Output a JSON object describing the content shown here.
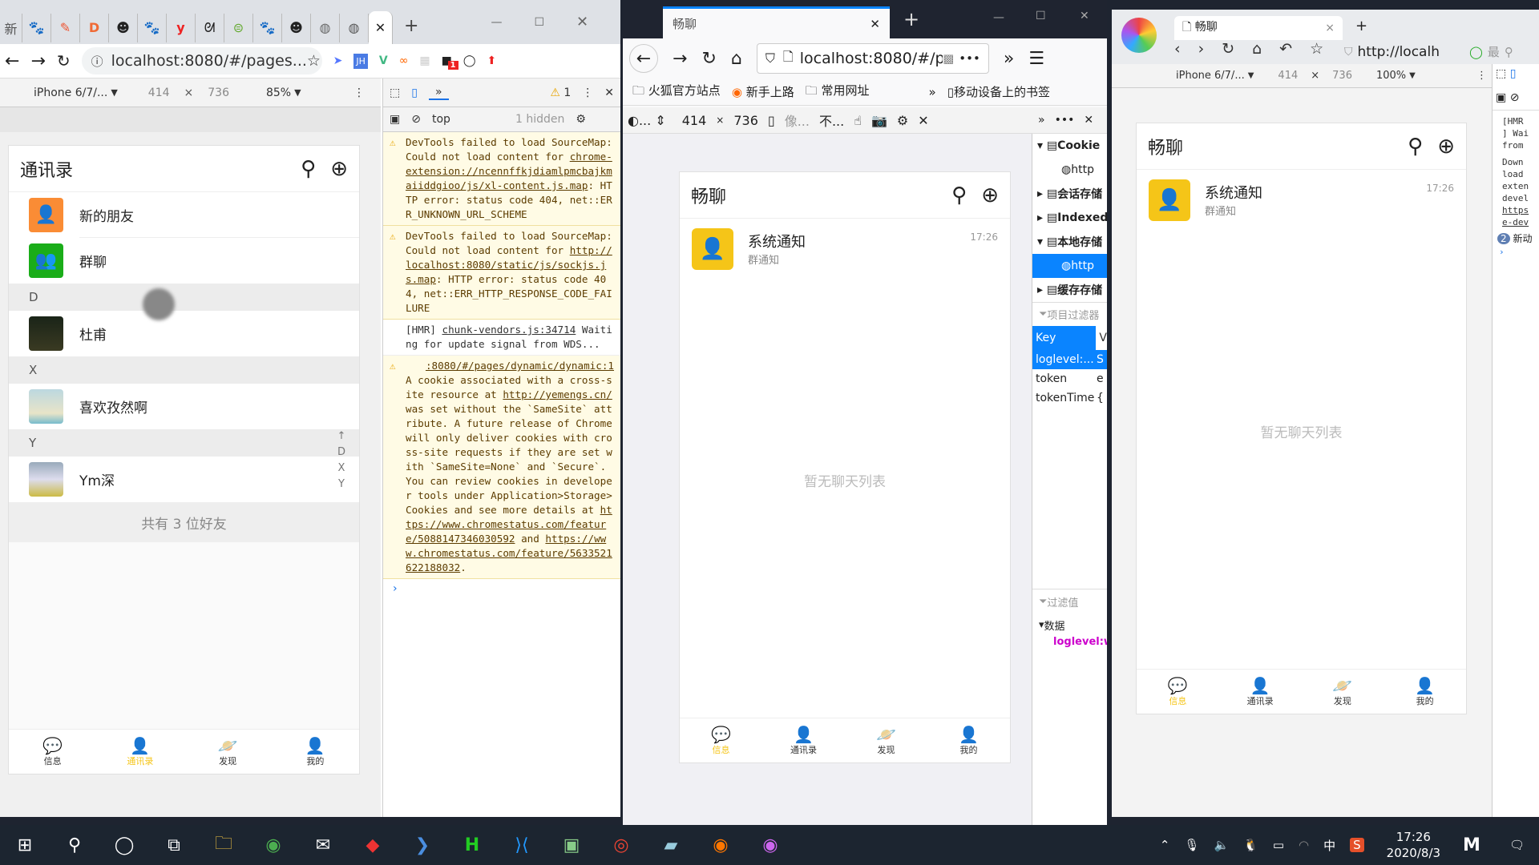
{
  "chrome": {
    "first_tab_label": "新",
    "tab_icons": [
      "baidu-paw-icon",
      "pen-icon",
      "d-logo-icon",
      "avatar-icon",
      "baidu-paw-icon",
      "youdao-icon",
      "calligraphy-icon",
      "code-icon",
      "baidu-paw-icon",
      "avatar-icon",
      "globe-icon",
      "globe-icon"
    ],
    "url": "localhost:8080/#/pages...",
    "extension_badge": "1",
    "device": "iPhone 6/7/...",
    "width": "414",
    "height": "736",
    "times": "×",
    "zoom": "85%"
  },
  "contacts_app": {
    "title": "通讯录",
    "special": [
      {
        "label": "新的朋友",
        "color": "#fa8c35"
      },
      {
        "label": "群聊",
        "color": "#1aad19"
      }
    ],
    "sections": [
      {
        "letter": "D",
        "contacts": [
          "杜甫"
        ]
      },
      {
        "letter": "X",
        "contacts": [
          "喜欢孜然啊"
        ]
      },
      {
        "letter": "Y",
        "contacts": [
          "Ym深"
        ]
      }
    ],
    "index_bar": [
      "↑",
      "D",
      "X",
      "Y"
    ],
    "count_text": "共有 3 位好友"
  },
  "tabbar": [
    {
      "label": "信息",
      "icon": "chat-icon"
    },
    {
      "label": "通讯录",
      "icon": "contacts-icon",
      "active": true
    },
    {
      "label": "发现",
      "icon": "planet-icon"
    },
    {
      "label": "我的",
      "icon": "user-icon"
    }
  ],
  "accent": "#f5c518",
  "devtools": {
    "warning_count": "1",
    "context": "top",
    "hidden": "1 hidden",
    "messages": [
      {
        "type": "warn",
        "text": "DevTools failed to load SourceMap: Could not load content for ",
        "link": "chrome-extension://ncennffkjdiamlpmcbajkmaiiddgioo/js/xl-content.js.map",
        "tail": ": HTTP error: status code 404, net::ERR_UNKNOWN_URL_SCHEME"
      },
      {
        "type": "warn",
        "text": "DevTools failed to load SourceMap: Could not load content for ",
        "link": "http://localhost:8080/static/js/sockjs.js.map",
        "tail": ": HTTP error: status code 404, net::ERR_HTTP_RESPONSE_CODE_FAILURE"
      },
      {
        "type": "info",
        "text": "[HMR] ",
        "link": "chunk-vendors.js:34714",
        "tail": " Waiting for update signal from WDS..."
      },
      {
        "type": "warn",
        "source": ":8080/#/pages/dynamic/dynamic:1",
        "text": "A cookie associated with a cross-site resource at ",
        "link": "http://yemengs.cn/",
        "tail": " was set without the `SameSite` attribute. A future release of Chrome will only deliver cookies with cross-site requests if they are set with `SameSite=None` and `Secure`. You can review cookies in developer tools under Application>Storage>Cookies and see more details at ",
        "link2": "https://www.chromestatus.com/feature/5088147346030592",
        "mid": " and ",
        "link3": "https://www.chromestatus.com/feature/5633521622188032",
        "end": "."
      }
    ],
    "prompt": "›"
  },
  "firefox": {
    "tab_title": "畅聊",
    "url": "localhost:8080/#/pages",
    "bookmarks": [
      "火狐官方站点",
      "新手上路",
      "常用网址"
    ],
    "mobile_bookmarks": "移动设备上的书签",
    "resp_device": "...",
    "width": "414",
    "height": "736",
    "dpr": "像...",
    "throttle": "不...",
    "storage": {
      "tree": [
        "Cookie",
        "http",
        "会话存储",
        "Indexed",
        "本地存储",
        "http",
        "缓存存储"
      ],
      "filter_placeholder": "项目过滤器",
      "key_header": "Key",
      "value_header": "V",
      "rows": [
        {
          "key": "loglevel:...",
          "value": "S"
        },
        {
          "key": "token",
          "value": "e"
        },
        {
          "key": "tokenTime",
          "value": "{"
        }
      ],
      "value_filter": "过滤值",
      "data_label": "数据",
      "data_item": "loglevel:w"
    }
  },
  "chat_app": {
    "title": "畅聊",
    "item": {
      "name": "系统通知",
      "subtitle": "群通知",
      "time": "17:26"
    },
    "empty": "暂无聊天列表"
  },
  "browser360": {
    "tab_title": "畅聊",
    "url": "http://localh",
    "search_hint": "最",
    "device": "iPhone 6/7/...",
    "width": "414",
    "height": "736",
    "zoom": "100%",
    "console_lines": [
      "[HMR",
      "] Wai",
      "from",
      "Down",
      "load",
      "exten",
      "devel",
      "https",
      "e-dev"
    ],
    "badge": "2",
    "badge_text": "新动"
  },
  "taskbar": {
    "time": "17:26",
    "date": "2020/8/3",
    "ime": "中"
  }
}
